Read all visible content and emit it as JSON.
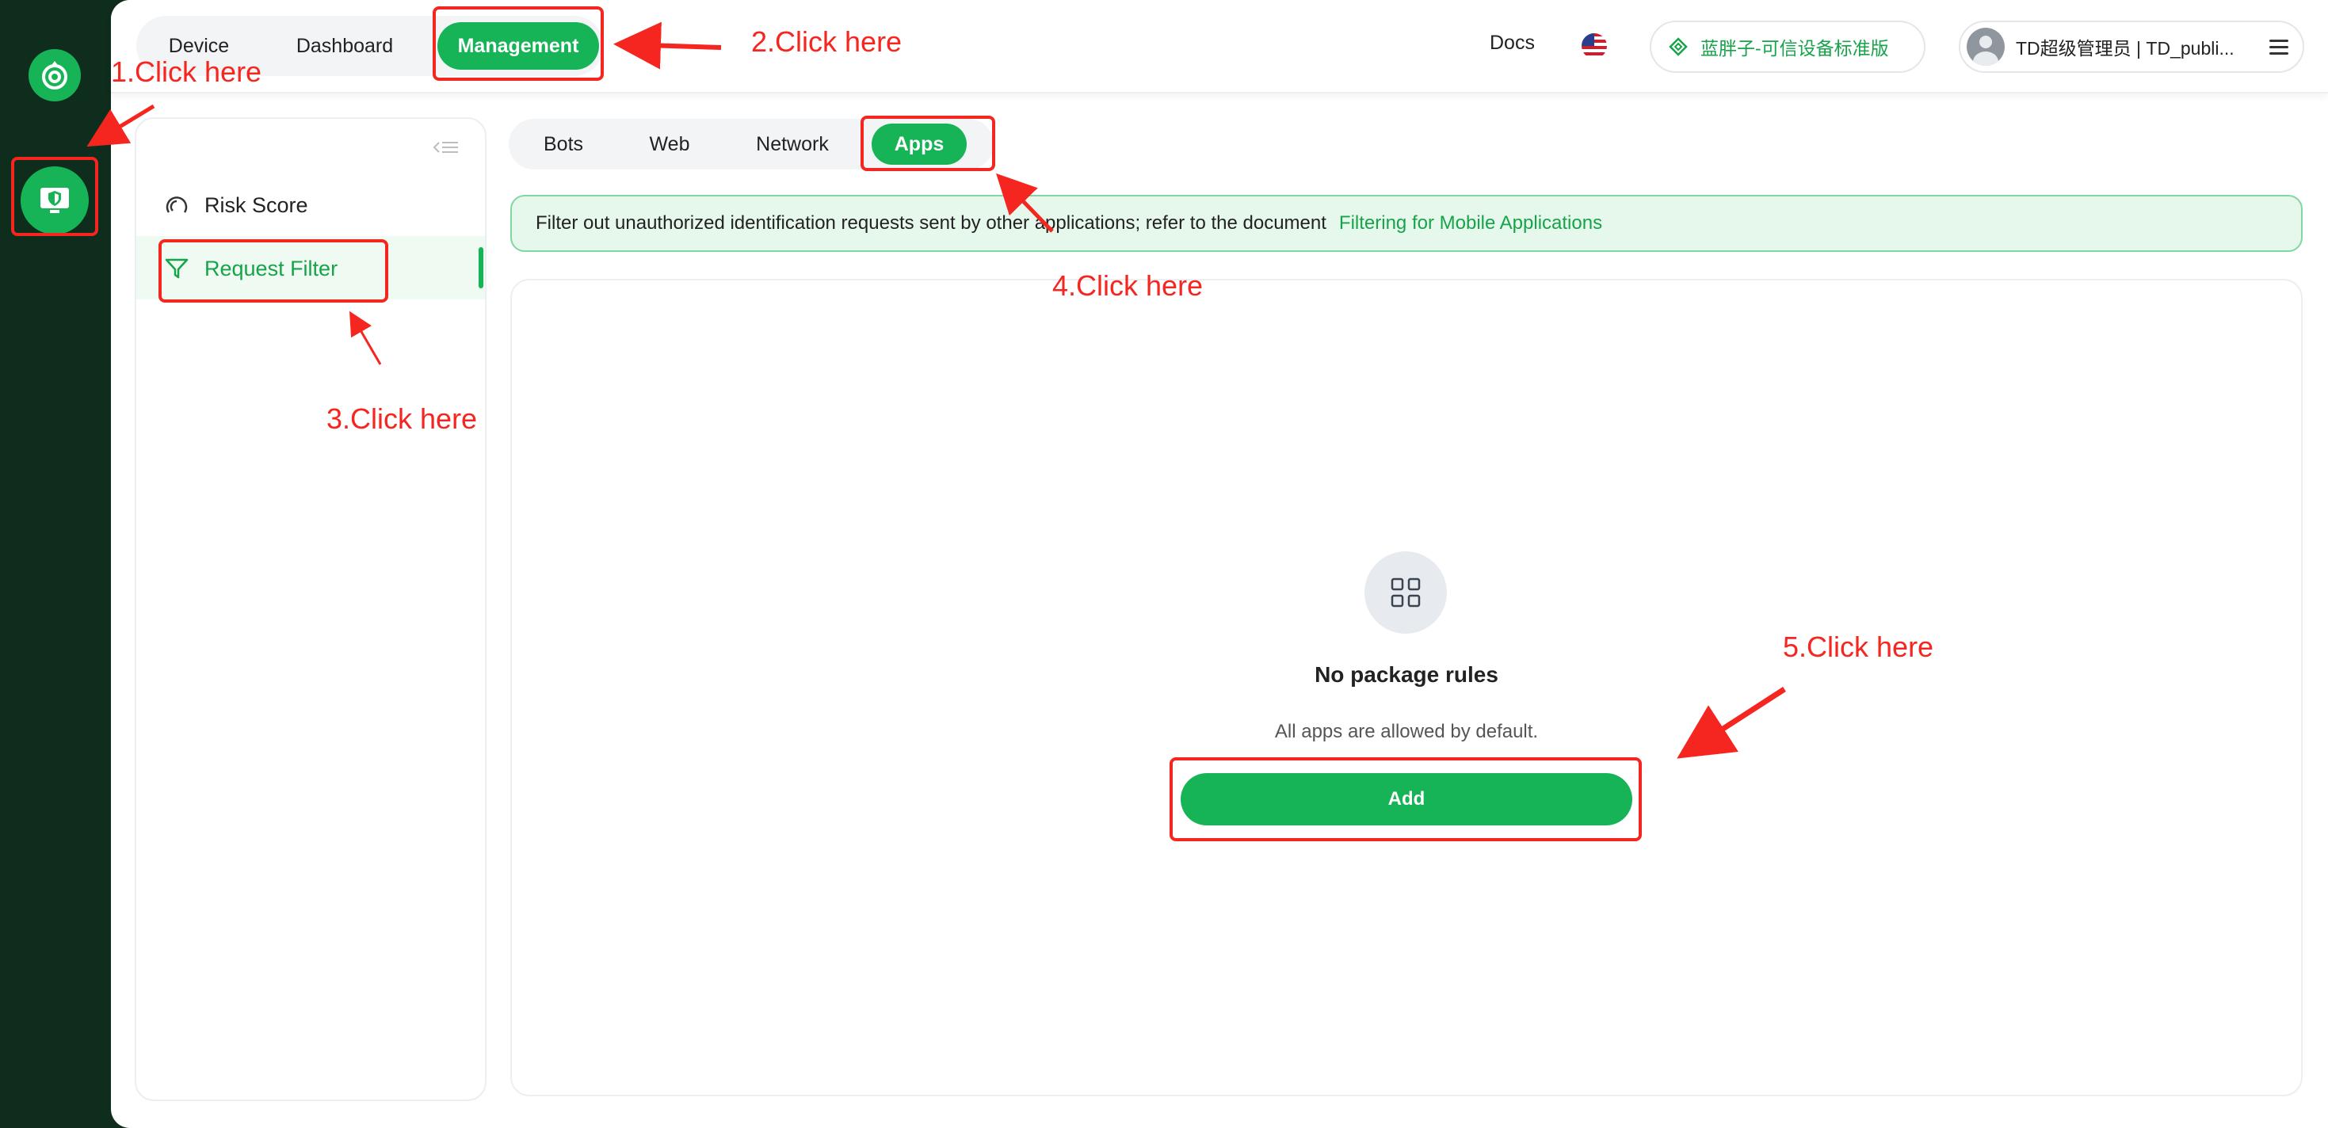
{
  "rail": {
    "logo_icon": "spiral-leaf-logo",
    "device_icon": "monitor-shield-icon"
  },
  "header": {
    "nav": [
      "Device",
      "Dashboard",
      "Management"
    ],
    "active_nav": "Management",
    "docs": "Docs",
    "language_icon": "us-flag-icon",
    "plan": "蓝胖子-可信设备标准版",
    "user": "TD超级管理员 | TD_publi..."
  },
  "sidebar": {
    "items": [
      {
        "label": "Risk Score",
        "icon": "gauge-icon"
      },
      {
        "label": "Request Filter",
        "icon": "filter-icon",
        "active": true
      }
    ]
  },
  "tabs": {
    "items": [
      "Bots",
      "Web",
      "Network",
      "Apps"
    ],
    "active": "Apps"
  },
  "info": {
    "text": "Filter out unauthorized identification requests sent by other applications; refer to the document",
    "link": "Filtering for Mobile Applications"
  },
  "empty": {
    "title": "No package rules",
    "desc": "All apps are allowed by default.",
    "add": "Add"
  },
  "annotations": [
    "1.Click here",
    "2.Click here",
    "3.Click here",
    "4.Click here",
    "5.Click here"
  ],
  "colors": {
    "brand": "#17b457",
    "annotation": "#f5261f",
    "rail": "#0f2d1c"
  }
}
